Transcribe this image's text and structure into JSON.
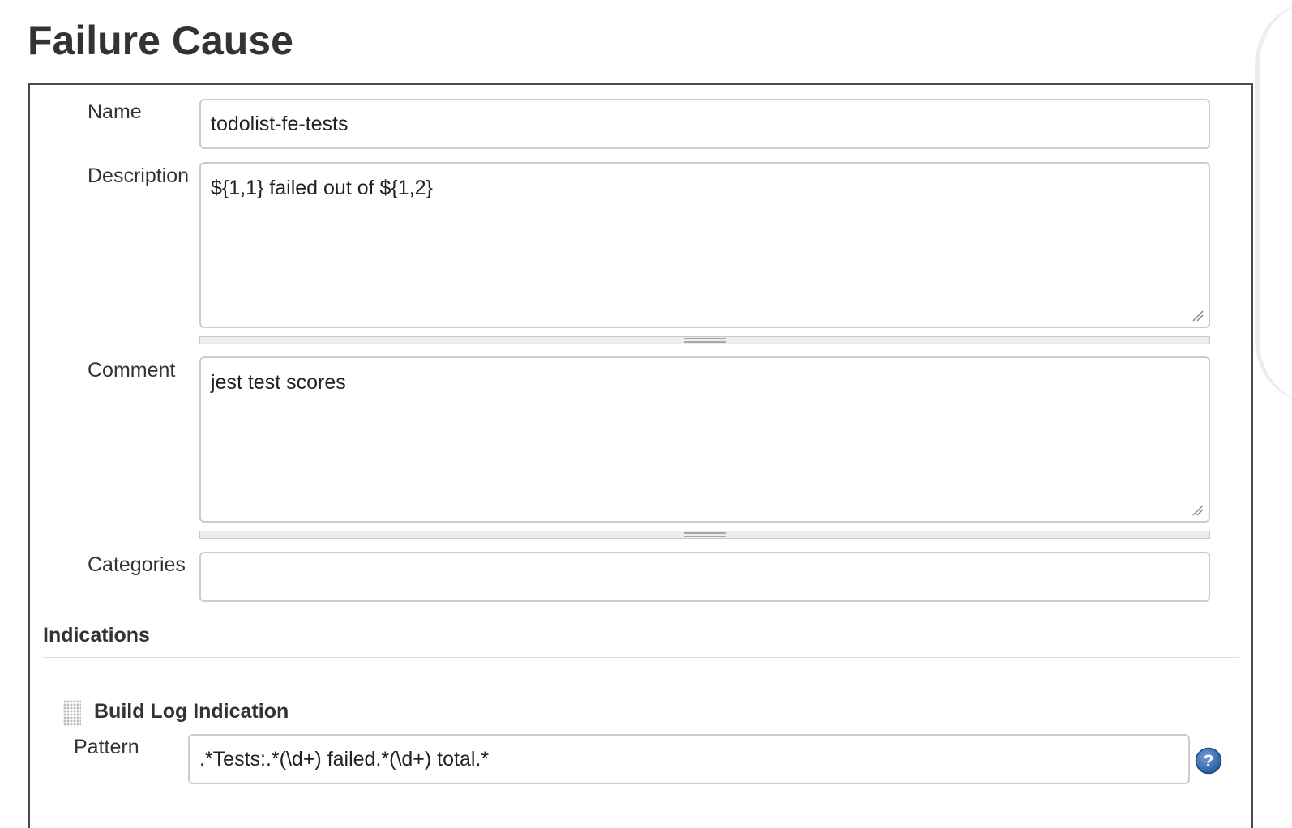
{
  "page": {
    "title": "Failure Cause"
  },
  "form": {
    "name": {
      "label": "Name",
      "value": "todolist-fe-tests"
    },
    "description": {
      "label": "Description",
      "value": "${1,1} failed out of ${1,2}"
    },
    "comment": {
      "label": "Comment",
      "value": "jest test scores"
    },
    "categories": {
      "label": "Categories",
      "value": ""
    }
  },
  "indications": {
    "header": "Indications",
    "build_log": {
      "title": "Build Log Indication",
      "pattern_label": "Pattern",
      "pattern_value": ".*Tests:.*(\\d+) failed.*(\\d+) total.*"
    }
  },
  "icons": {
    "help": "help-icon",
    "drag": "drag-handle-icon",
    "resize": "resize-grip-icon"
  },
  "colors": {
    "panel_border": "#4a4a4a",
    "field_border": "#cccccc",
    "help_icon": "#2b5c9e"
  }
}
